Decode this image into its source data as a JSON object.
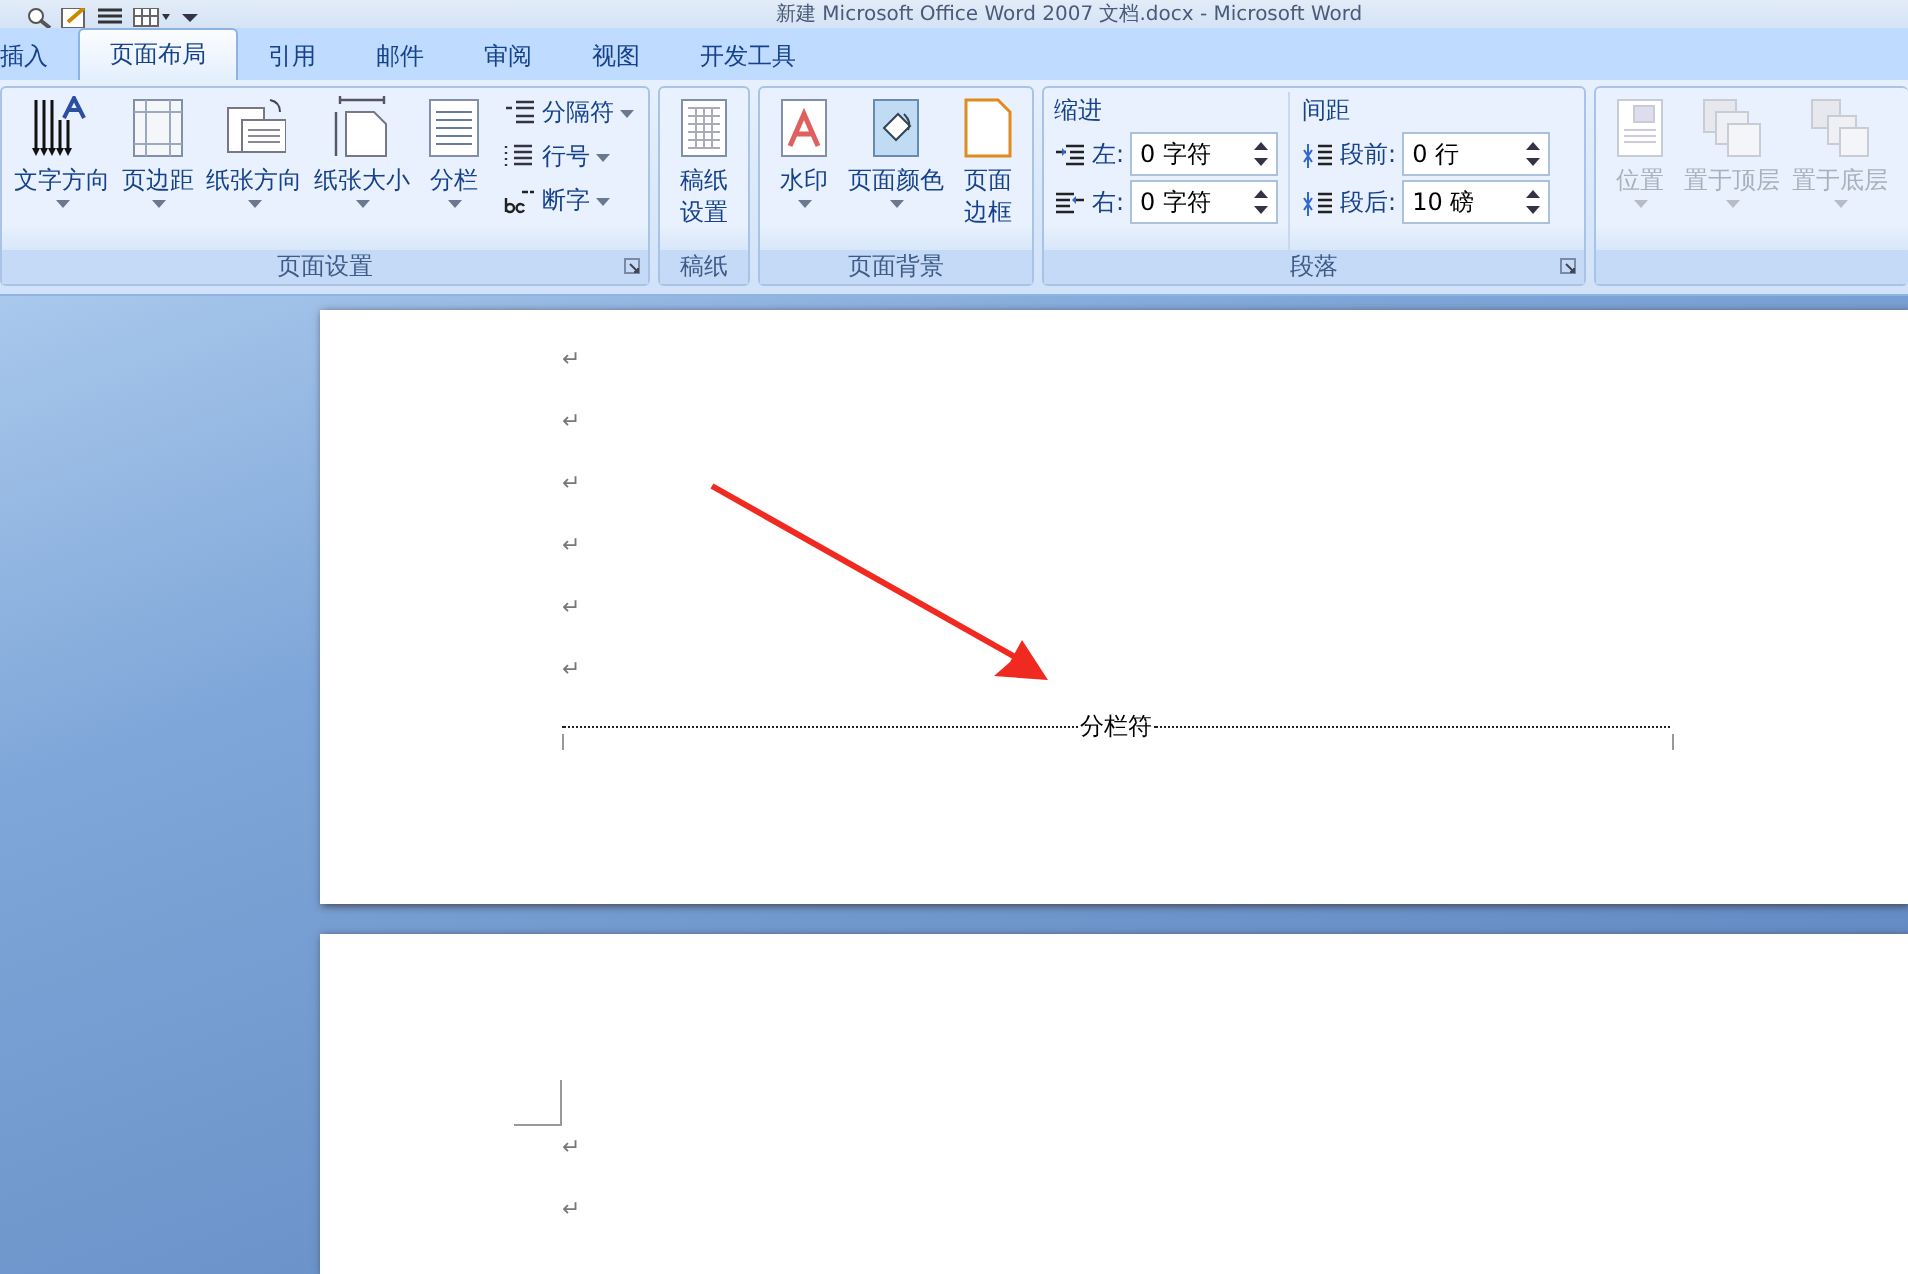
{
  "window": {
    "title": "新建 Microsoft Office Word 2007 文档.docx - Microsoft Word"
  },
  "tabs": [
    {
      "label": "插入",
      "selected": false
    },
    {
      "label": "页面布局",
      "selected": true
    },
    {
      "label": "引用",
      "selected": false
    },
    {
      "label": "邮件",
      "selected": false
    },
    {
      "label": "审阅",
      "selected": false
    },
    {
      "label": "视图",
      "selected": false
    },
    {
      "label": "开发工具",
      "selected": false
    }
  ],
  "ribbon": {
    "groups": [
      {
        "label": "页面设置",
        "launcher": true,
        "items": [
          {
            "kind": "large",
            "label": "文字方向",
            "dropdown": true,
            "disabled": false
          },
          {
            "kind": "large",
            "label": "页边距",
            "dropdown": true,
            "disabled": false
          },
          {
            "kind": "large",
            "label": "纸张方向",
            "dropdown": true,
            "disabled": false
          },
          {
            "kind": "large",
            "label": "纸张大小",
            "dropdown": true,
            "disabled": false
          },
          {
            "kind": "large",
            "label": "分栏",
            "dropdown": true,
            "disabled": false
          },
          {
            "kind": "stack",
            "buttons": [
              {
                "label": "分隔符",
                "dropdown": true
              },
              {
                "label": "行号",
                "dropdown": true
              },
              {
                "label": "断字",
                "dropdown": true
              }
            ]
          }
        ]
      },
      {
        "label": "稿纸",
        "launcher": false,
        "items": [
          {
            "kind": "large",
            "label": [
              "稿纸",
              "设置"
            ],
            "dropdown": false,
            "disabled": false
          }
        ]
      },
      {
        "label": "页面背景",
        "launcher": false,
        "items": [
          {
            "kind": "large",
            "label": "水印",
            "dropdown": true,
            "disabled": false
          },
          {
            "kind": "large",
            "label": "页面颜色",
            "dropdown": true,
            "disabled": false
          },
          {
            "kind": "large",
            "label": [
              "页面",
              "边框"
            ],
            "dropdown": false,
            "disabled": false
          }
        ]
      },
      {
        "label": "段落",
        "launcher": true,
        "items": [
          {
            "kind": "fields",
            "label": "缩进",
            "fields": [
              {
                "label": "左:",
                "value": "0 字符"
              },
              {
                "label": "右:",
                "value": "0 字符"
              }
            ]
          },
          {
            "kind": "fields",
            "label": "间距",
            "fields": [
              {
                "label": "段前:",
                "value": "0 行"
              },
              {
                "label": "段后:",
                "value": "10 磅"
              }
            ]
          }
        ]
      },
      {
        "launcher": false,
        "items": [
          {
            "kind": "large",
            "label": "位置",
            "dropdown": true,
            "disabled": true
          },
          {
            "kind": "large",
            "label": "置于顶层",
            "dropdown": true,
            "disabled": true
          },
          {
            "kind": "large",
            "label": "置于底层",
            "dropdown": true,
            "disabled": true
          }
        ]
      }
    ]
  },
  "document": {
    "pages": [
      {
        "paragraph_marks": [
          "↵",
          "↵",
          "↵",
          "↵",
          "↵",
          "↵"
        ],
        "column_break": "分栏符"
      },
      {
        "paragraph_marks": [
          "↵",
          "↵"
        ]
      }
    ]
  }
}
